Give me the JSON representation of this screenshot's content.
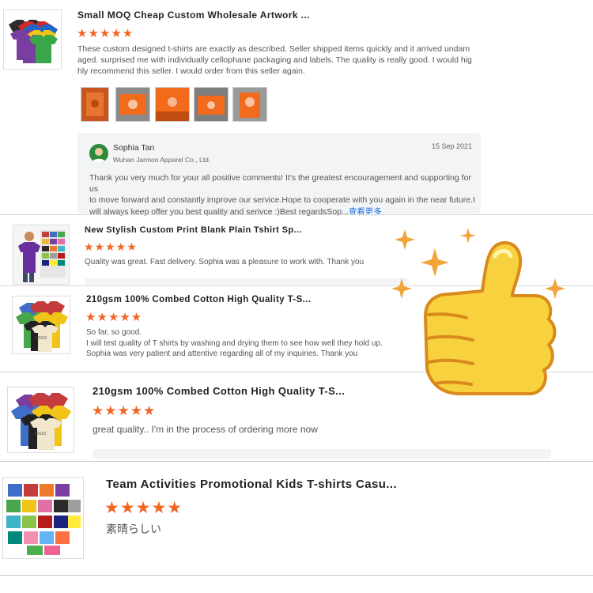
{
  "reviews": [
    {
      "title": "Small MOQ Cheap Custom Wholesale Artwork ...",
      "stars": "★★★★★",
      "lines": [
        "These custom designed t-shirts are exactly as described. Seller shipped items quickly and it arrived undam",
        "aged. surprised me with individually cellophane packaging and labels. The quality is really good. I would hig",
        "hly recommend this seller. I would order from this seller again."
      ],
      "reply": {
        "name": "Sophia Tan",
        "company": "Wuhan Jarmoo Apparel Co., Ltd.",
        "date": "15 Sep 2021",
        "lines": [
          "Thank you very much for your all positive comments! It's the greatest encouragement and supporting for us",
          "to move forward and constantly improve our service.Hope to cooperate with you again in the near future.I",
          "will always keep offer you best quality and serivce :)Best regardsSop..."
        ],
        "more": "查看更多"
      }
    },
    {
      "title": "New Stylish Custom Print Blank Plain Tshirt Sp...",
      "stars": "★★★★★",
      "lines": [
        "Quality was great. Fast delivery. Sophia was a pleasure to work with. Thank you"
      ]
    },
    {
      "title": "210gsm 100% Combed Cotton High Quality T-S...",
      "stars": "★★★★★",
      "lines": [
        "So far, so good.",
        "I will test quality of T shirts by washing and drying them to see how well they hold up.",
        "Sophia was very patient and attentive regarding all of my inquiries. Thank you"
      ]
    },
    {
      "title": "210gsm 100% Combed Cotton High Quality T-S...",
      "stars": "★★★★★",
      "lines": [
        "great quality.. I'm in the process of ordering more now"
      ]
    },
    {
      "title": "Team Activities Promotional Kids T-shirts Casu...",
      "stars": "★★★★★",
      "lines": [
        "素晴らしい"
      ]
    }
  ],
  "colors": {
    "star": "#f26522",
    "link": "#1a73e8",
    "reply_bg": "#f3f4f6",
    "thumbs_up": "#f7d23e",
    "thumbs_outline": "#d98a1c"
  },
  "icons": [
    "star-icon",
    "thumbs-up-icon",
    "sparkle-icon",
    "avatar-icon"
  ]
}
